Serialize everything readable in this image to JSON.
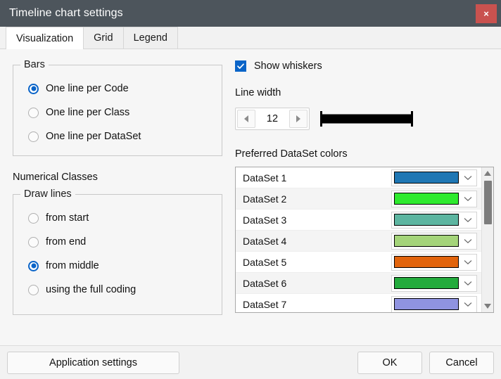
{
  "window": {
    "title": "Timeline chart settings",
    "close_label": "×",
    "titlebar_color": "#4d555c",
    "close_color": "#c9524f"
  },
  "tabs": [
    {
      "label": "Visualization",
      "active": true
    },
    {
      "label": "Grid",
      "active": false
    },
    {
      "label": "Legend",
      "active": false
    }
  ],
  "left": {
    "bars_group": {
      "title": "Bars",
      "options": [
        {
          "label": "One line per Code",
          "checked": true
        },
        {
          "label": "One line per Class",
          "checked": false
        },
        {
          "label": "One line per DataSet",
          "checked": false
        }
      ]
    },
    "numerical_classes_label": "Numerical Classes",
    "draw_lines_group": {
      "title": "Draw lines",
      "options": [
        {
          "label": "from start",
          "checked": false
        },
        {
          "label": "from end",
          "checked": false
        },
        {
          "label": "from middle",
          "checked": true
        },
        {
          "label": "using the full coding",
          "checked": false
        }
      ]
    }
  },
  "right": {
    "show_whiskers": {
      "label": "Show whiskers",
      "checked": true
    },
    "line_width": {
      "label": "Line width",
      "value": "12",
      "decrement_icon": "triangle-left-icon",
      "increment_icon": "triangle-right-icon",
      "preview_color": "#000000"
    },
    "preferred_colors": {
      "label": "Preferred DataSet colors",
      "rows": [
        {
          "name": "DataSet 1",
          "color": "#1f77b4"
        },
        {
          "name": "DataSet 2",
          "color": "#2eea2e"
        },
        {
          "name": "DataSet 3",
          "color": "#5cb5a0"
        },
        {
          "name": "DataSet 4",
          "color": "#a4d479"
        },
        {
          "name": "DataSet 5",
          "color": "#e2640c"
        },
        {
          "name": "DataSet 6",
          "color": "#23ab3c"
        },
        {
          "name": "DataSet 7",
          "color": "#8f93e0"
        }
      ]
    }
  },
  "footer": {
    "application_settings": "Application settings",
    "ok": "OK",
    "cancel": "Cancel"
  }
}
